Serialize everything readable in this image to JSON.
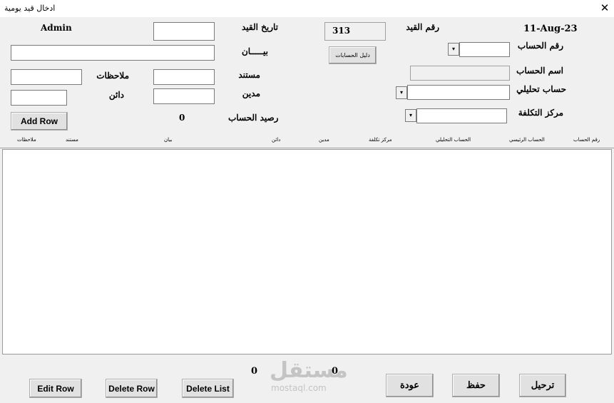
{
  "window": {
    "title": "ادخال قيد يومية",
    "close": "✕"
  },
  "header": {
    "date": "11-Aug-23",
    "user": "Admin"
  },
  "form": {
    "entry_no_label": "رقم القيد",
    "entry_no_value": "313",
    "entry_date_label": "تاريخ القيد",
    "description_label": "بيـــــان",
    "accounts_guide_button": "دليل الحسابات",
    "account_no_label": "رقم الحساب",
    "account_name_label": "اسم الحساب",
    "analytic_account_label": "حساب تحليلي",
    "cost_center_label": "مركز التكلفة",
    "document_label": "مستند",
    "notes_label": "ملاحظات",
    "debit_label": "مدين",
    "credit_label": "دائن",
    "account_balance_label": "رصيد الحساب",
    "account_balance_value": "0",
    "add_row_button": "Add Row",
    "dropdown_arrow": "▾"
  },
  "table": {
    "columns": [
      "رقم الحساب",
      "الحساب الرئيسي",
      "الحساب التحليلي",
      "مركز تكلفة",
      "مدين",
      "دائن",
      "بيان",
      "مستند",
      "ملاحظات"
    ]
  },
  "footer": {
    "edit_row_button": "Edit Row",
    "delete_row_button": "Delete Row",
    "delete_list_button": "Delete List",
    "total_credit": "0",
    "total_debit": "0",
    "back_button": "عودة",
    "save_button": "حفظ",
    "post_button": "ترحيل"
  },
  "watermark": {
    "arabic": "مستقل",
    "latin": "mostaql.com"
  }
}
